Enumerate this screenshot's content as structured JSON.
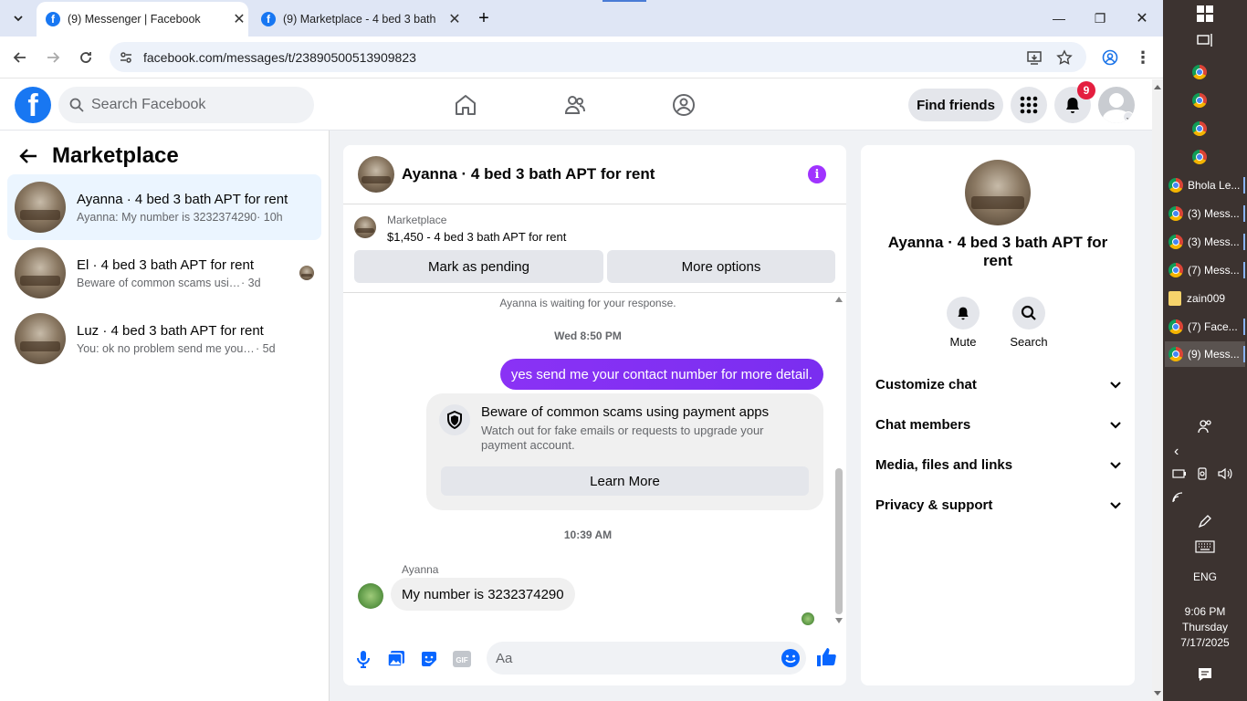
{
  "browser": {
    "tabs": [
      {
        "title": "(9) Messenger | Facebook",
        "active": true
      },
      {
        "title": "(9) Marketplace - 4 bed 3 bath",
        "active": false
      }
    ],
    "url": "facebook.com/messages/t/23890500513909823"
  },
  "fb": {
    "search_placeholder": "Search Facebook",
    "find_friends": "Find friends",
    "notification_count": "9"
  },
  "left": {
    "title": "Marketplace",
    "conversations": [
      {
        "name": "Ayanna · 4 bed 3 bath APT for rent",
        "snippet": "Ayanna: My number is 3232374290",
        "time": "· 10h",
        "active": true
      },
      {
        "name": "El · 4 bed 3 bath APT for rent",
        "snippet": "Beware of common scams using payment apps",
        "time": "· 3d",
        "active": false
      },
      {
        "name": "Luz · 4 bed 3 bath APT for rent",
        "snippet": "You: ok no problem send me your contact",
        "time": "· 5d",
        "active": false
      }
    ]
  },
  "chat": {
    "title": "Ayanna · 4 bed 3 bath APT for rent",
    "marketplace_label": "Marketplace",
    "listing": "$1,450 - 4 bed 3 bath APT for rent",
    "mark_pending": "Mark as pending",
    "more_options": "More options",
    "waiting_notice": "Ayanna is waiting for your response.",
    "time1": "Wed 8:50 PM",
    "outgoing": "yes send me your contact number for more detail.",
    "scam_title": "Beware of common scams using payment apps",
    "scam_desc": "Watch out for fake emails or requests to upgrade your payment account.",
    "learn_more": "Learn More",
    "time2": "10:39 AM",
    "sender": "Ayanna",
    "incoming": "My number is 3232374290",
    "composer_placeholder": "Aa"
  },
  "info": {
    "name": "Ayanna · 4 bed 3 bath APT for rent",
    "mute": "Mute",
    "search": "Search",
    "rows": [
      "Customize chat",
      "Chat members",
      "Media, files and links",
      "Privacy & support"
    ]
  },
  "taskbar": {
    "items": [
      {
        "label": "",
        "icon": "chrome-icon"
      },
      {
        "label": "",
        "icon": "chrome-icon"
      },
      {
        "label": "",
        "icon": "chrome-icon"
      },
      {
        "label": "",
        "icon": "chrome-icon"
      },
      {
        "label": "Bhola Le...",
        "icon": "chrome-icon"
      },
      {
        "label": "(3) Mess...",
        "icon": "chrome-icon"
      },
      {
        "label": "(3) Mess...",
        "icon": "chrome-icon"
      },
      {
        "label": "(7) Mess...",
        "icon": "chrome-icon"
      },
      {
        "label": "zain009",
        "icon": "folder-icon"
      },
      {
        "label": "(7) Face...",
        "icon": "chrome-icon"
      },
      {
        "label": "(9) Mess...",
        "icon": "chrome-icon"
      }
    ],
    "lang": "ENG",
    "time": "9:06 PM",
    "day": "Thursday",
    "date": "7/17/2025"
  },
  "colors": {
    "fb_blue": "#1877f2",
    "messenger_purple": "#8a32f5",
    "taskbar": "#3c3330"
  }
}
